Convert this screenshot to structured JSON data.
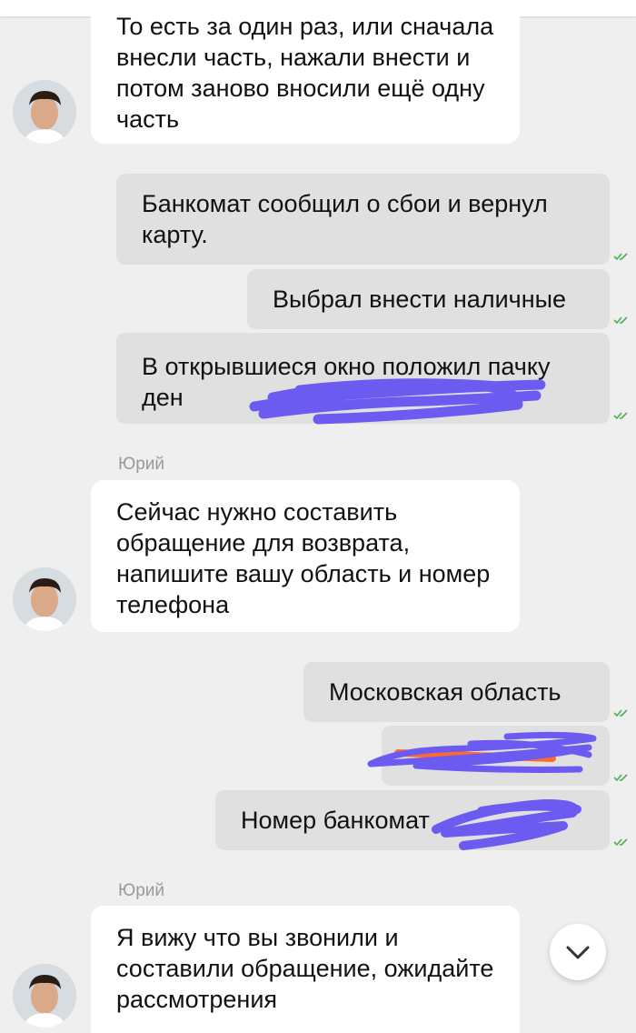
{
  "messages": [
    {
      "sender": "",
      "text": "То есть за один раз, или сначала внесли часть, нажали внести и потом заново вносили ещё одну часть"
    },
    {
      "text": "Банкомат сообщил о сбои  и вернул карту."
    },
    {
      "text": "Выбрал внести наличные"
    },
    {
      "text": "В открывшиеся окно положил пачку ден"
    },
    {
      "sender": "Юрий",
      "text": "Сейчас нужно составить обращение для возврата, напишите вашу область и номер телефона"
    },
    {
      "text": "Московская область"
    },
    {
      "text": ""
    },
    {
      "text": "Номер банкомат"
    },
    {
      "sender": "Юрий",
      "text": "Я вижу что вы звонили и составили обращение, ожидайте рассмотрения"
    }
  ],
  "colors": {
    "background": "#efefef",
    "incoming_bubble": "#ffffff",
    "outgoing_bubble": "#e0e0e0",
    "read_check": "#4caf50",
    "redaction": "#6b5bf0",
    "redaction_accent": "#ff6a2c",
    "brand": "#21a038"
  },
  "icons": {
    "read_receipt": "double-check-icon",
    "scroll_down": "chevron-down-icon"
  }
}
